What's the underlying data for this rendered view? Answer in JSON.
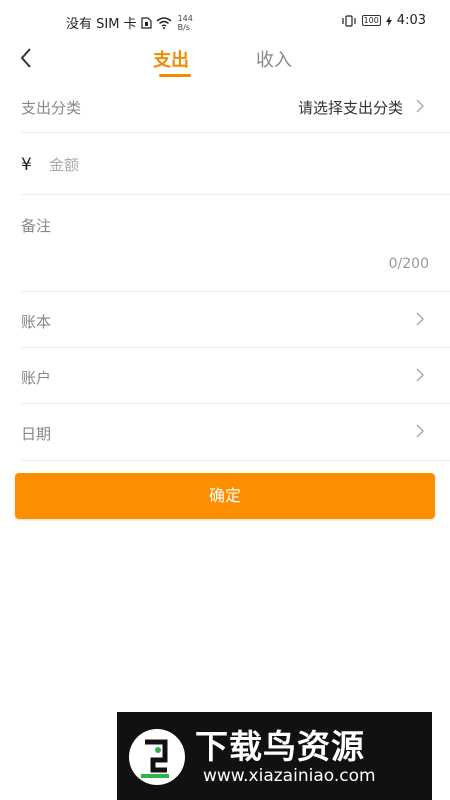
{
  "status_bar": {
    "carrier": "没有 SIM 卡",
    "net_speed_value": "144",
    "net_speed_unit": "B/s",
    "battery": "100",
    "time": "4:03"
  },
  "nav": {
    "tabs": [
      {
        "label": "支出",
        "active": true
      },
      {
        "label": "收入",
        "active": false
      }
    ],
    "accent_color": "#f08c00"
  },
  "form": {
    "category": {
      "label": "支出分类",
      "placeholder": "请选择支出分类"
    },
    "amount": {
      "currency_symbol": "¥",
      "placeholder": "金额",
      "value": ""
    },
    "note": {
      "label": "备注",
      "value": "",
      "counter": "0/200"
    },
    "ledger": {
      "label": "账本"
    },
    "account": {
      "label": "账户"
    },
    "date": {
      "label": "日期"
    }
  },
  "confirm_button": {
    "label": "确定",
    "color": "#fb8f00"
  },
  "watermark": {
    "title": "下载鸟资源",
    "url": "www.xiazainiao.com"
  }
}
